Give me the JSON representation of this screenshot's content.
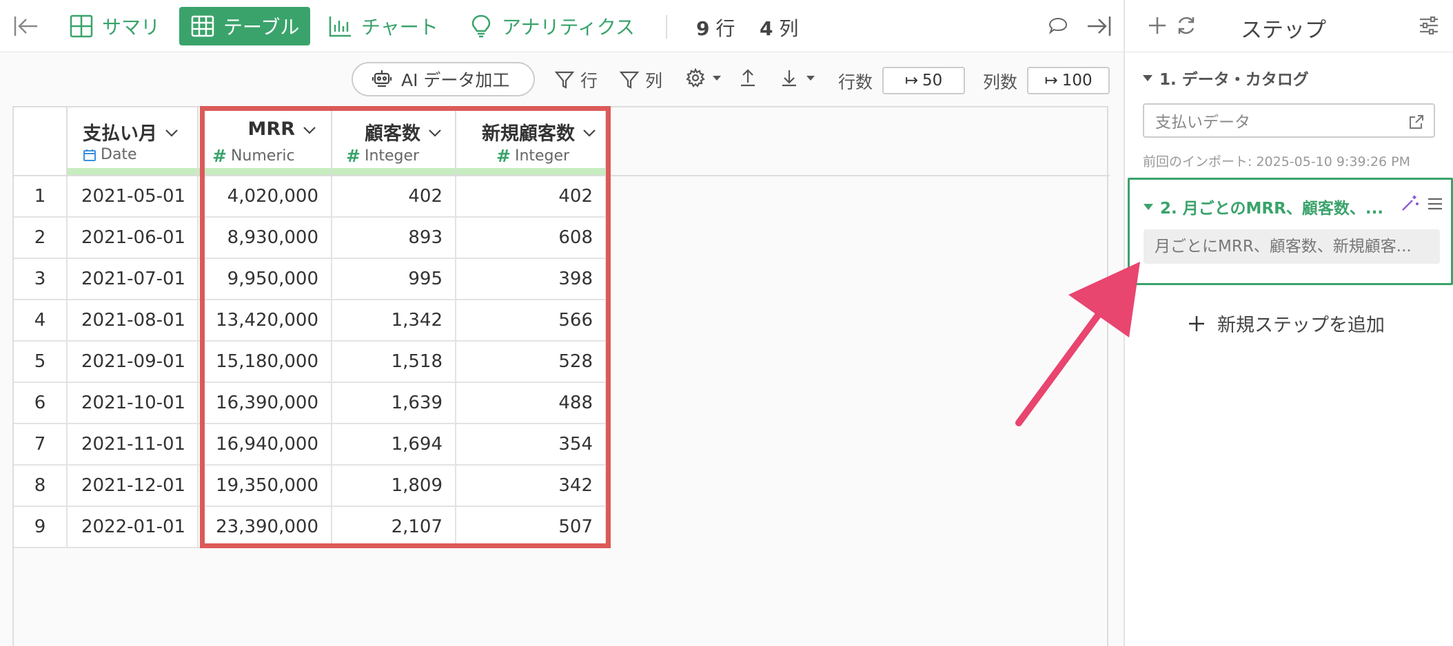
{
  "toolbar": {
    "tabs": [
      {
        "label": "サマリ",
        "icon": "grid-icon"
      },
      {
        "label": "テーブル",
        "icon": "table-icon",
        "active": true
      },
      {
        "label": "チャート",
        "icon": "bar-chart-icon"
      },
      {
        "label": "アナリティクス",
        "icon": "lightbulb-icon"
      }
    ],
    "rows_count": "9",
    "rows_unit": "行",
    "cols_count": "4",
    "cols_unit": "列"
  },
  "subtoolbar": {
    "ai_label": "AI データ加工",
    "row_filter_label": "行",
    "col_filter_label": "列",
    "rows_label": "行数",
    "rows_value": "50",
    "cols_label": "列数",
    "cols_value": "100"
  },
  "table": {
    "columns": [
      {
        "name": "支払い月",
        "type": "Date"
      },
      {
        "name": "MRR",
        "type": "Numeric"
      },
      {
        "name": "顧客数",
        "type": "Integer"
      },
      {
        "name": "新規顧客数",
        "type": "Integer"
      }
    ],
    "rows": [
      [
        "1",
        "2021-05-01",
        "4,020,000",
        "402",
        "402"
      ],
      [
        "2",
        "2021-06-01",
        "8,930,000",
        "893",
        "608"
      ],
      [
        "3",
        "2021-07-01",
        "9,950,000",
        "995",
        "398"
      ],
      [
        "4",
        "2021-08-01",
        "13,420,000",
        "1,342",
        "566"
      ],
      [
        "5",
        "2021-09-01",
        "15,180,000",
        "1,518",
        "528"
      ],
      [
        "6",
        "2021-10-01",
        "16,390,000",
        "1,639",
        "488"
      ],
      [
        "7",
        "2021-11-01",
        "16,940,000",
        "1,694",
        "354"
      ],
      [
        "8",
        "2021-12-01",
        "19,350,000",
        "1,809",
        "342"
      ],
      [
        "9",
        "2022-01-01",
        "23,390,000",
        "2,107",
        "507"
      ]
    ]
  },
  "panel": {
    "title": "ステップ",
    "step1_title": "1. データ・カタログ",
    "step1_source": "支払いデータ",
    "step1_import": "前回のインポート: 2025-05-10 9:39:26 PM",
    "step2_title": "2. 月ごとのMRR、顧客数、...",
    "step2_desc": "月ごとにMRR、顧客数、新規顧客...",
    "add_step_label": "新規ステップを追加"
  },
  "colors": {
    "accent": "#3aa36b",
    "highlight": "#dc5a58",
    "arrow": "#e8456f",
    "type_bar": "#c7ecc0"
  }
}
